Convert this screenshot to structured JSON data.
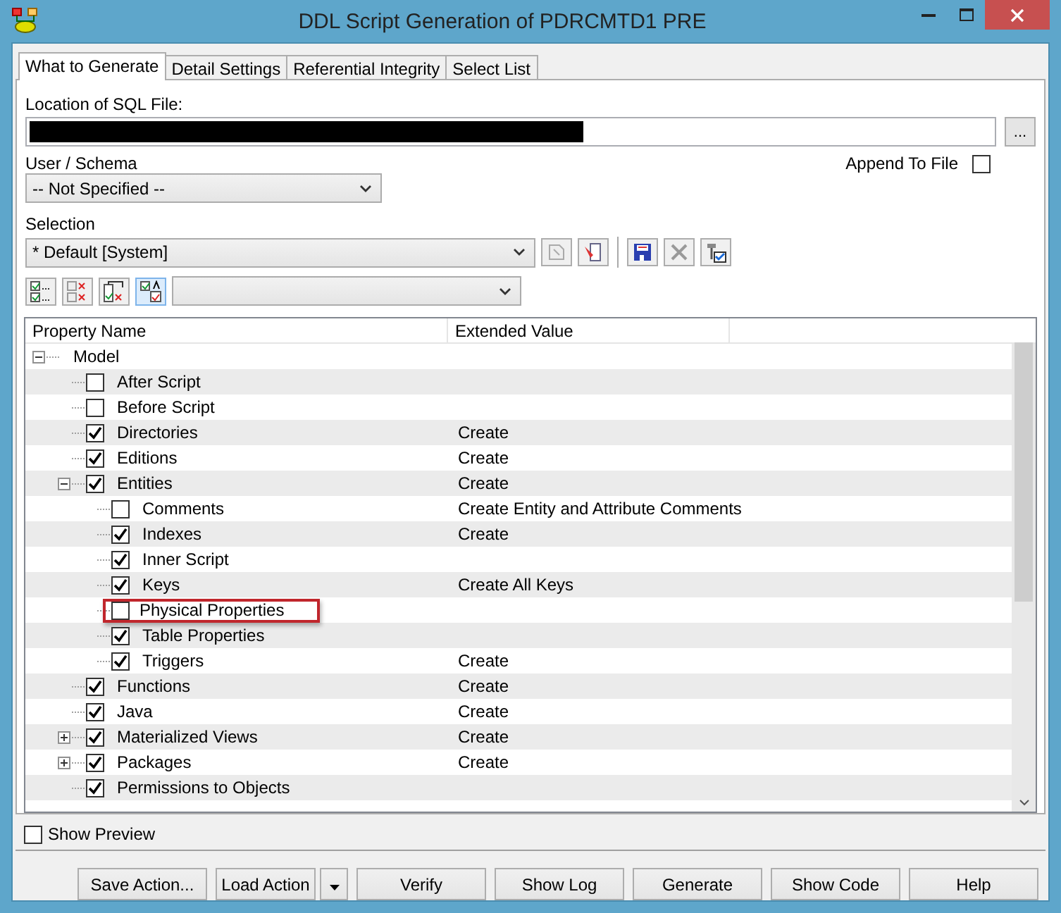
{
  "window": {
    "title": "DDL Script Generation of PDRCMTD1 PRE"
  },
  "tabs": [
    {
      "label": "What to Generate",
      "selected": true
    },
    {
      "label": "Detail Settings",
      "selected": false
    },
    {
      "label": "Referential Integrity",
      "selected": false
    },
    {
      "label": "Select List",
      "selected": false
    }
  ],
  "location": {
    "label": "Location of SQL File:",
    "browse": "..."
  },
  "append": {
    "label": "Append To File",
    "checked": false
  },
  "schema": {
    "label": "User / Schema",
    "value": "-- Not Specified --"
  },
  "selection": {
    "label": "Selection",
    "value": "* Default [System]"
  },
  "tree": {
    "columns": [
      "Property Name",
      "Extended Value"
    ],
    "items": [
      {
        "name": "Model",
        "expanded": true,
        "children": [
          {
            "name": "After Script",
            "checked": false
          },
          {
            "name": "Before Script",
            "checked": false
          },
          {
            "name": "Directories",
            "checked": true,
            "value": "Create"
          },
          {
            "name": "Editions",
            "checked": true,
            "value": "Create"
          },
          {
            "name": "Entities",
            "checked": true,
            "value": "Create",
            "expanded": true,
            "children": [
              {
                "name": "Comments",
                "checked": false,
                "value": "Create Entity and Attribute Comments"
              },
              {
                "name": "Indexes",
                "checked": true,
                "value": "Create"
              },
              {
                "name": "Inner Script",
                "checked": true
              },
              {
                "name": "Keys",
                "checked": true,
                "value": "Create All Keys"
              },
              {
                "name": "Physical Properties",
                "checked": false,
                "highlighted": true
              },
              {
                "name": "Table Properties",
                "checked": true
              },
              {
                "name": "Triggers",
                "checked": true,
                "value": "Create"
              }
            ]
          },
          {
            "name": "Functions",
            "checked": true,
            "value": "Create"
          },
          {
            "name": "Java",
            "checked": true,
            "value": "Create"
          },
          {
            "name": "Materialized Views",
            "checked": true,
            "value": "Create",
            "expanded": false
          },
          {
            "name": "Packages",
            "checked": true,
            "value": "Create",
            "expanded": false
          },
          {
            "name": "Permissions to Objects",
            "checked": true
          }
        ]
      }
    ]
  },
  "preview": {
    "label": "Show Preview",
    "checked": false
  },
  "buttons": [
    {
      "label": "Save Action...",
      "kind": "button"
    },
    {
      "label": "Load Action",
      "kind": "split"
    },
    {
      "label": "Verify",
      "kind": "button"
    },
    {
      "label": "Show Log",
      "kind": "button"
    },
    {
      "label": "Generate",
      "kind": "button"
    },
    {
      "label": "Show Code",
      "kind": "button"
    },
    {
      "label": "Help",
      "kind": "button"
    }
  ]
}
